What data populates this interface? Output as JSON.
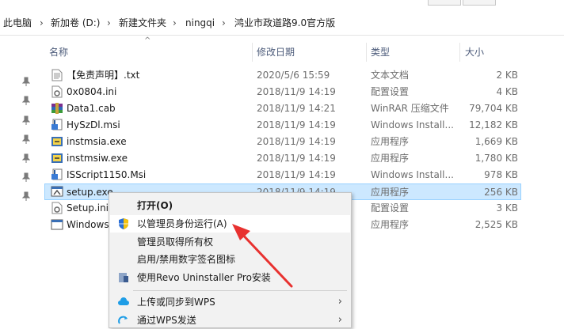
{
  "breadcrumb": [
    "此电脑",
    "新加卷 (D:)",
    "新建文件夹",
    "ningqi",
    "鸿业市政道路9.0官方版"
  ],
  "columns": {
    "name": "名称",
    "date": "修改日期",
    "type": "类型",
    "size": "大小"
  },
  "files": [
    {
      "name": "【免责声明】.txt",
      "date": "2020/5/6 15:59",
      "type": "文本文档",
      "size": "2 KB",
      "icon": "text-file-icon"
    },
    {
      "name": "0x0804.ini",
      "date": "2018/11/9 14:19",
      "type": "配置设置",
      "size": "4 KB",
      "icon": "ini-file-icon"
    },
    {
      "name": "Data1.cab",
      "date": "2018/11/9 14:21",
      "type": "WinRAR 压缩文件",
      "size": "79,704 KB",
      "icon": "winrar-icon"
    },
    {
      "name": "HySzDl.msi",
      "date": "2018/11/9 14:19",
      "type": "Windows Install...",
      "size": "12,182 KB",
      "icon": "msi-icon"
    },
    {
      "name": "instmsia.exe",
      "date": "2018/11/9 14:19",
      "type": "应用程序",
      "size": "1,669 KB",
      "icon": "installer-exe-icon"
    },
    {
      "name": "instmsiw.exe",
      "date": "2018/11/9 14:19",
      "type": "应用程序",
      "size": "1,780 KB",
      "icon": "installer-exe-icon"
    },
    {
      "name": "ISScript1150.Msi",
      "date": "2018/11/9 14:19",
      "type": "Windows Install...",
      "size": "978 KB",
      "icon": "msi-icon"
    },
    {
      "name": "setup.exe",
      "date": "2018/11/9 14:19",
      "type": "应用程序",
      "size": "256 KB",
      "icon": "setup-exe-icon"
    },
    {
      "name": "Setup.ini",
      "date": "",
      "type": "配置设置",
      "size": "3 KB",
      "icon": "ini-file-icon"
    },
    {
      "name": "Windows",
      "date": "",
      "type": "应用程序",
      "size": "2,525 KB",
      "icon": "window-app-icon"
    }
  ],
  "selected_index": 7,
  "context_menu": [
    {
      "label": "打开(O)",
      "bold": true,
      "icon": ""
    },
    {
      "label": "以管理员身份运行(A)",
      "icon": "uac-shield-icon"
    },
    {
      "label": "管理员取得所有权",
      "icon": ""
    },
    {
      "label": "启用/禁用数字签名图标",
      "icon": ""
    },
    {
      "label": "使用Revo Uninstaller Pro安装",
      "icon": "revo-uninstaller-icon"
    },
    {
      "label": "上传或同步到WPS",
      "icon": "wps-cloud-icon",
      "submenu": true
    },
    {
      "label": "通过WPS发送",
      "icon": "wps-send-icon",
      "submenu": true
    }
  ],
  "colors": {
    "selection": "#cce8ff",
    "selection_border": "#99d1ff",
    "annotation_arrow": "#e8312f"
  }
}
